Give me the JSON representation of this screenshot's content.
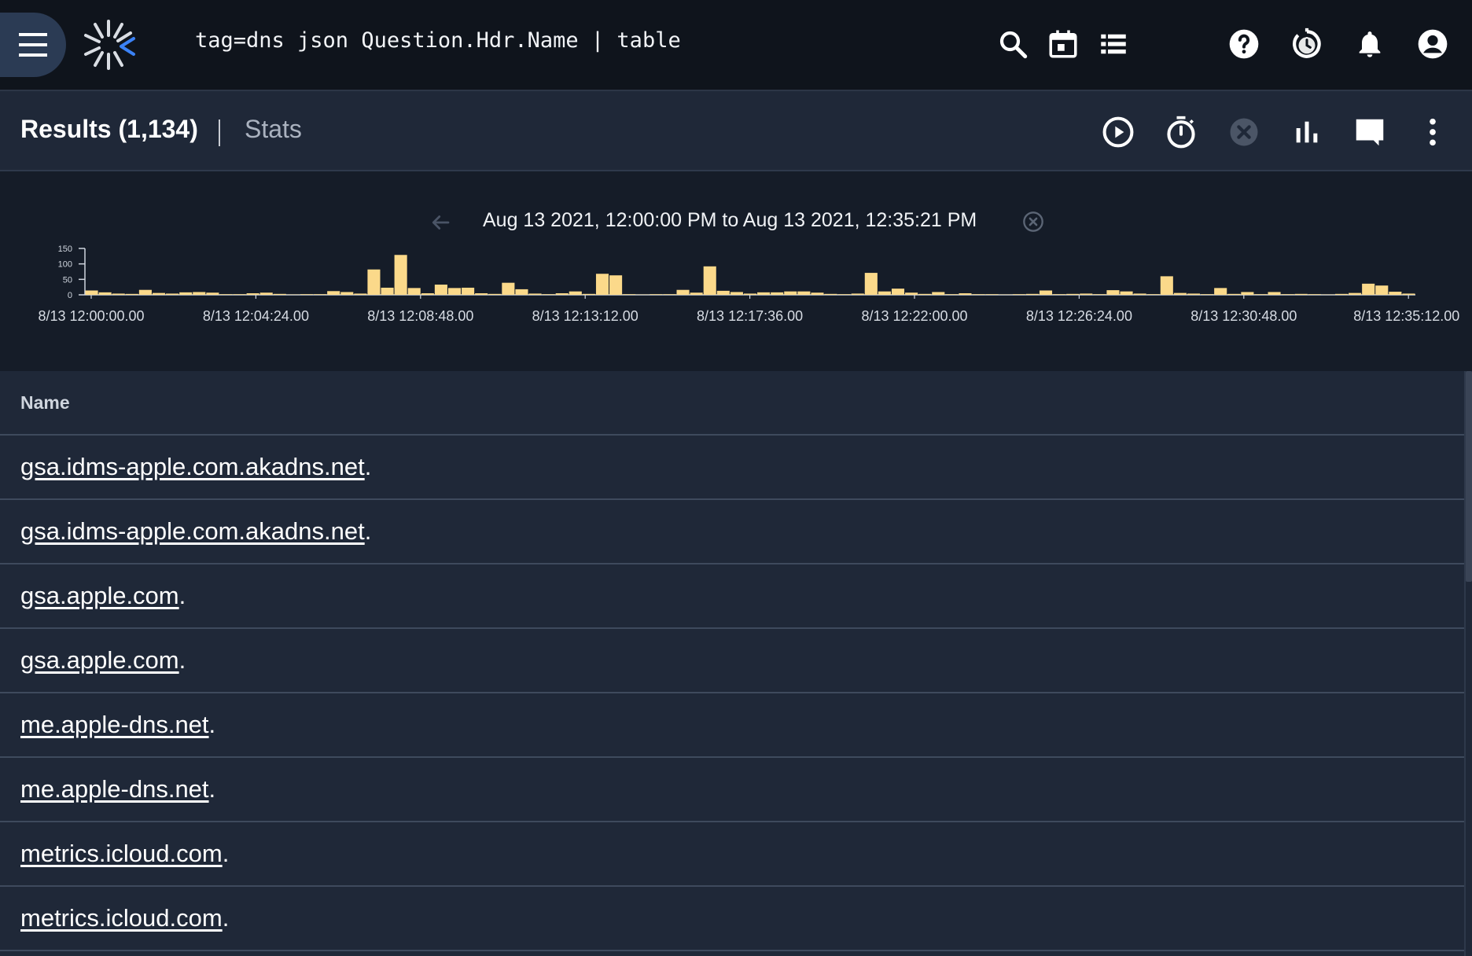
{
  "header": {
    "query": "tag=dns json Question.Hdr.Name | table",
    "icons": [
      "menu-icon",
      "logo-icon",
      "search-icon",
      "calendar-icon",
      "list-icon",
      "help-icon",
      "history-icon",
      "bell-icon",
      "account-icon"
    ]
  },
  "results_bar": {
    "title": "Results (1,134)",
    "stats_label": "Stats",
    "icons": [
      "play-icon",
      "timer-icon",
      "cancel-icon",
      "chart-icon",
      "comment-icon",
      "more-vert-icon"
    ]
  },
  "overview": {
    "range_label": "Aug 13 2021, 12:00:00 PM to Aug 13 2021, 12:35:21 PM"
  },
  "chart_data": {
    "type": "bar",
    "title": "",
    "xlabel": "",
    "ylabel": "",
    "ylim": [
      0,
      150
    ],
    "yticks": [
      "150",
      "100",
      "50",
      "0"
    ],
    "bar_color": "#fbd98a",
    "xticks": [
      "8/13 12:00:00.00",
      "8/13 12:04:24.00",
      "8/13 12:08:48.00",
      "8/13 12:13:12.00",
      "8/13 12:17:36.00",
      "8/13 12:22:00.00",
      "8/13 12:26:24.00",
      "8/13 12:30:48.00",
      "8/13 12:35:12.00"
    ],
    "values": [
      14,
      8,
      4,
      3,
      16,
      6,
      4,
      8,
      9,
      7,
      2,
      2,
      5,
      7,
      3,
      1,
      2,
      2,
      12,
      9,
      4,
      82,
      23,
      129,
      22,
      5,
      33,
      22,
      23,
      5,
      3,
      39,
      18,
      4,
      2,
      5,
      11,
      3,
      68,
      63,
      2,
      1,
      2,
      2,
      16,
      7,
      92,
      13,
      9,
      4,
      8,
      8,
      11,
      11,
      7,
      3,
      2,
      4,
      71,
      11,
      20,
      7,
      3,
      9,
      2,
      5,
      2,
      2,
      1,
      2,
      3,
      14,
      2,
      3,
      4,
      2,
      15,
      11,
      4,
      2,
      60,
      6,
      4,
      2,
      22,
      3,
      9,
      2,
      9,
      2,
      3,
      2,
      1,
      3,
      6,
      36,
      30,
      10,
      4
    ]
  },
  "table": {
    "header": "Name",
    "rows": [
      "gsa.idms-apple.com.akadns.net",
      "gsa.idms-apple.com.akadns.net",
      "gsa.apple.com",
      "gsa.apple.com",
      "me.apple-dns.net",
      "me.apple-dns.net",
      "metrics.icloud.com",
      "metrics.icloud.com"
    ],
    "row_suffix": "."
  }
}
